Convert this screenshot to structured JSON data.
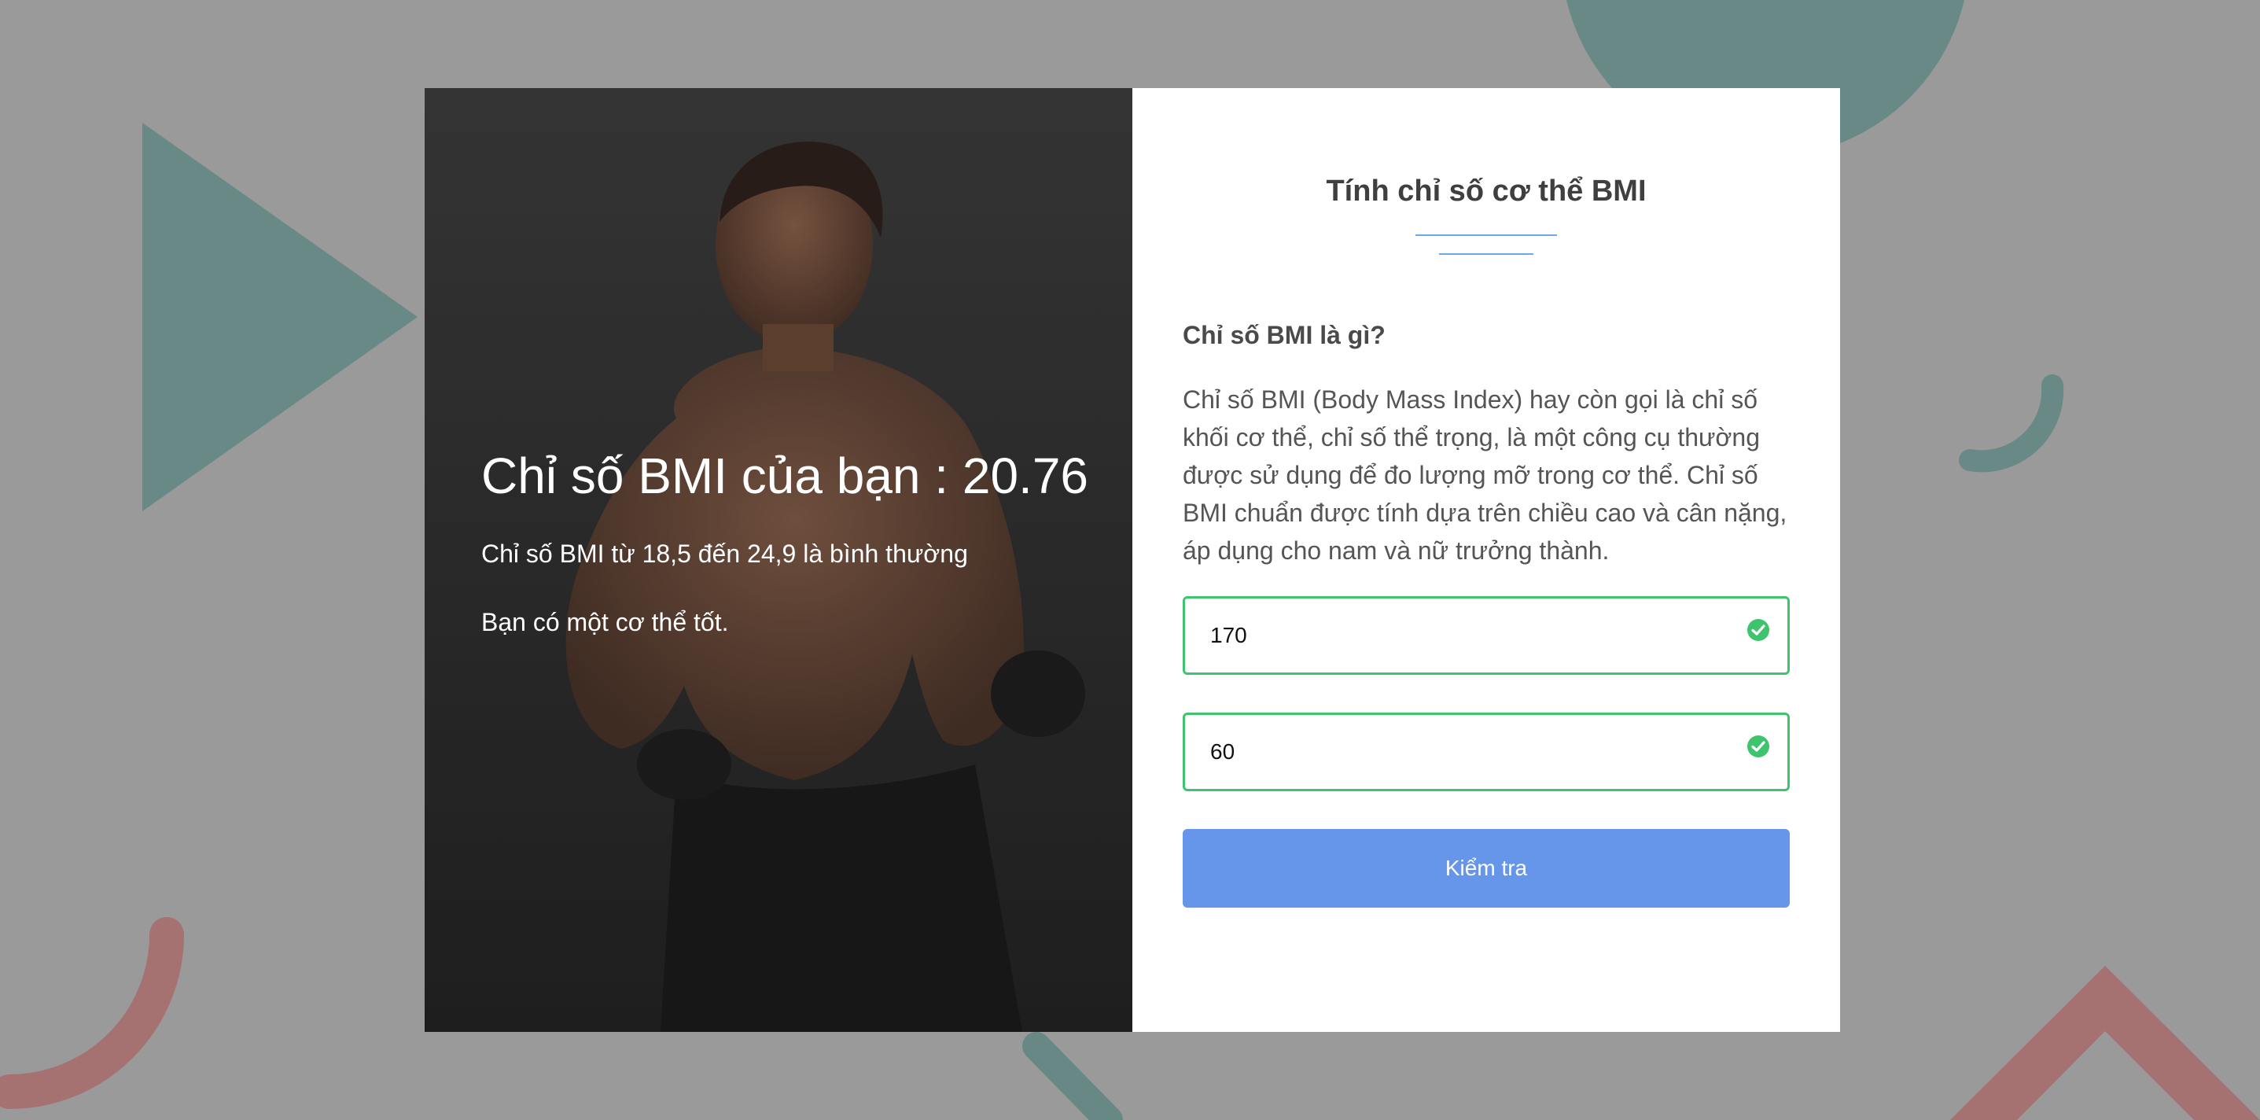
{
  "result": {
    "title": "Chỉ số BMI của bạn : 20.76",
    "normal_range": "Chỉ số BMI từ 18,5 đến 24,9 là bình thường",
    "verdict": "Bạn có một cơ thể tốt."
  },
  "form": {
    "title": "Tính chỉ số cơ thể BMI",
    "section_heading": "Chỉ số BMI là gì?",
    "section_body": "Chỉ số BMI (Body Mass Index) hay còn gọi là chỉ số khối cơ thể, chỉ số thể trọng, là một công cụ thường được sử dụng để đo lượng mỡ trong cơ thể. Chỉ số BMI chuẩn được tính dựa trên chiều cao và cân nặng, áp dụng cho nam và nữ trưởng thành.",
    "height_value": "170",
    "weight_value": "60",
    "submit_label": "Kiểm tra"
  },
  "icons": {
    "height_valid": "check-circle-icon",
    "weight_valid": "check-circle-icon"
  },
  "colors": {
    "accent": "#6696ea",
    "valid": "#3ec46d",
    "divider": "#6fa8e6",
    "backdrop": "#9a9a9a",
    "shape_teal": "#5f8682",
    "shape_red": "#a86a6a"
  }
}
